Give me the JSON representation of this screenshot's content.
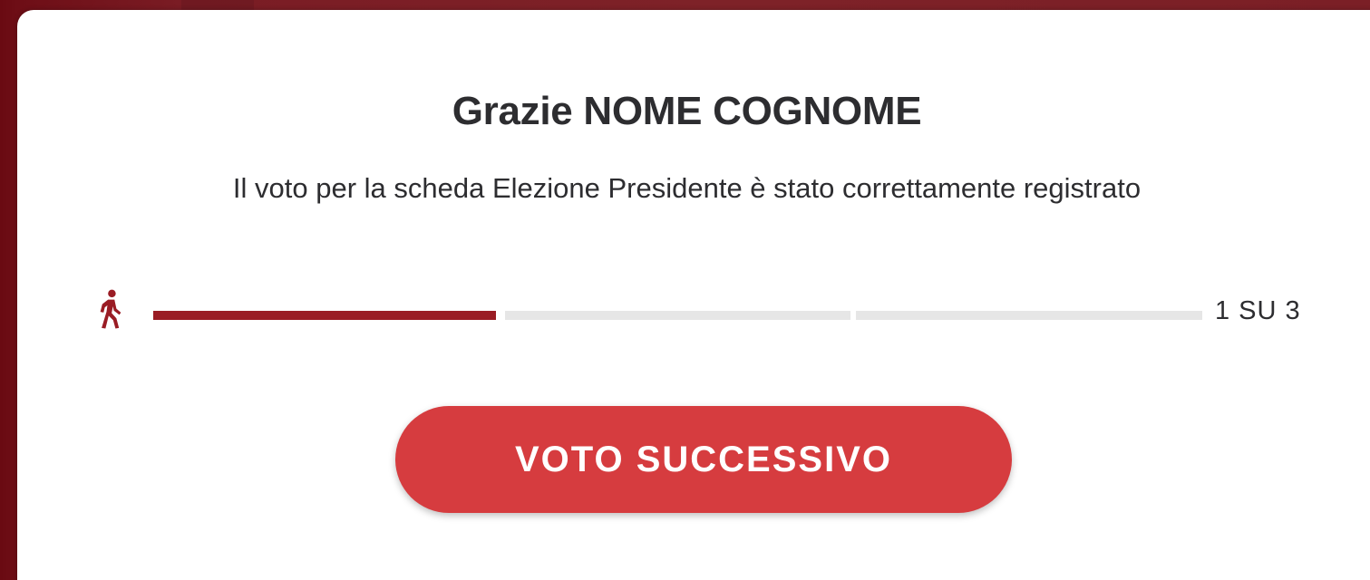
{
  "modal": {
    "title": "Grazie NOME COGNOME",
    "message": "Il voto per la scheda Elezione Presidente è stato correttamente registrato"
  },
  "progress": {
    "icon": "walking-person-icon",
    "current_step": 1,
    "total_steps": 3,
    "counter_text": "1 SU 3",
    "active_color": "#9a1c24",
    "inactive_color": "#e6e6e6"
  },
  "actions": {
    "next_label": "VOTO SUCCESSIVO",
    "button_color": "#d63c3f"
  }
}
